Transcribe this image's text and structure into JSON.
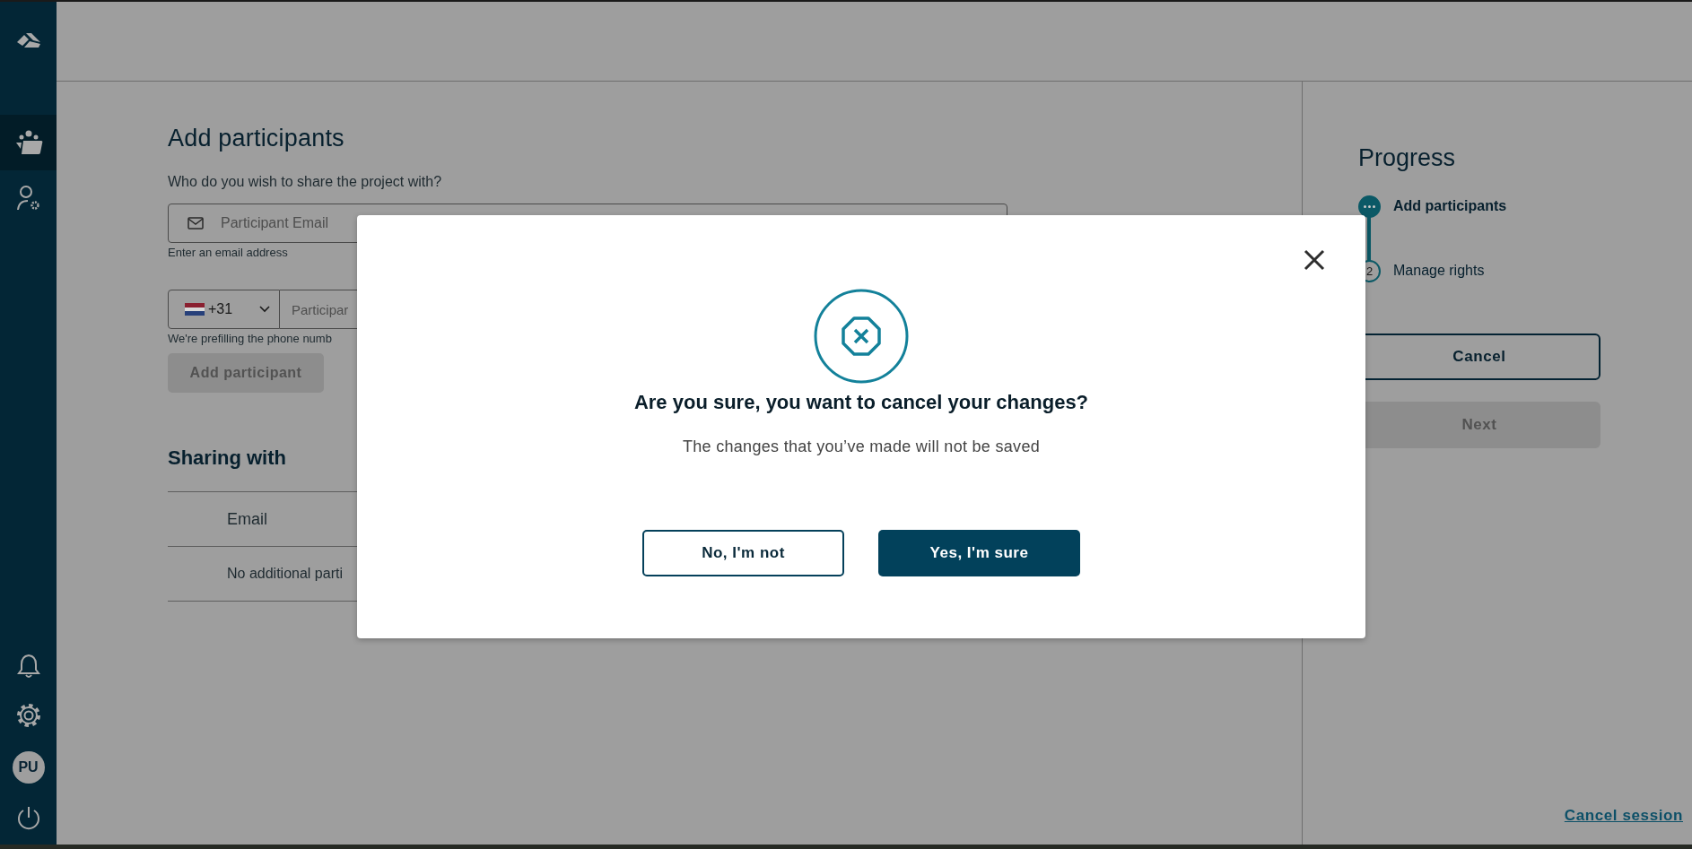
{
  "sidebar": {
    "top": [
      {
        "kind": "logo",
        "selected": false
      },
      {
        "kind": "projects",
        "selected": true
      },
      {
        "kind": "user-settings",
        "selected": false
      }
    ],
    "bottom": [
      {
        "kind": "bell"
      },
      {
        "kind": "settings"
      },
      {
        "kind": "avatar",
        "initials": "PU"
      },
      {
        "kind": "power"
      }
    ]
  },
  "form": {
    "title": "Add participants",
    "question": "Who do you wish to share the project with?",
    "email_field": {
      "placeholder": "Participant Email",
      "hint": "Enter an email address"
    },
    "phone_field": {
      "country_code": "+31",
      "placeholder": "Participar",
      "hint": "We're prefilling the phone numb"
    },
    "add_button": {
      "label": "Add participant",
      "disabled": true
    },
    "sharing": {
      "title": "Sharing with",
      "column": "Email",
      "empty": "No additional parti"
    }
  },
  "progress": {
    "title": "Progress",
    "steps": [
      {
        "label": "Add participants",
        "selected": true
      },
      {
        "label": "Manage rights",
        "number": "2",
        "selected": false
      }
    ],
    "cancel_button": {
      "label": "Cancel",
      "disabled": false
    },
    "next_button": {
      "label": "Next",
      "disabled": true
    },
    "cancel_session": "Cancel session"
  },
  "dialog": {
    "title": "Are you sure, you want to cancel your changes?",
    "message": "The changes that you’ve made will not be saved",
    "buttons": [
      {
        "label": "No, I'm not",
        "kind": "secondary"
      },
      {
        "label": "Yes, I'm sure",
        "kind": "primary"
      }
    ]
  }
}
